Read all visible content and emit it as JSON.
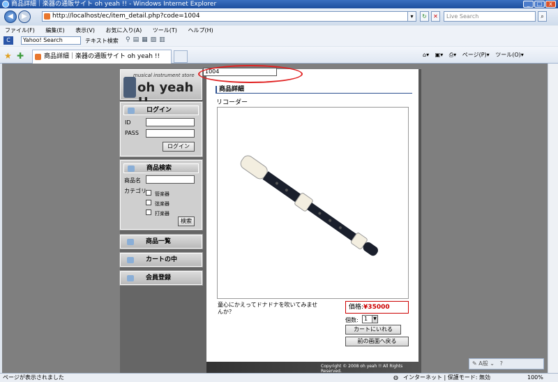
{
  "window": {
    "title": "商品詳細｜楽器の通販サイト oh yeah !! - Windows Internet Explorer"
  },
  "browser": {
    "address": "http://localhost/ec/item_detail.php?code=1004",
    "search_placeholder": "Live Search",
    "menu": [
      "ファイル(F)",
      "編集(E)",
      "表示(V)",
      "お気に入り(A)",
      "ツール(T)",
      "ヘルプ(H)"
    ],
    "yahoo_search": "Yahoo! Search",
    "text_search": "テキスト検索",
    "tab_title": "商品詳細｜楽器の通販サイト oh yeah !!",
    "page_menu": "ページ(P)",
    "tools_menu": "ツール(O)",
    "status_text": "ページが表示されました",
    "zone": "インターネット | 保護モード: 無効",
    "zoom": "100%"
  },
  "site": {
    "logo_small": "musical instrument store",
    "logo_big": "oh yeah !!",
    "login": {
      "title": "ログイン",
      "id_label": "ID",
      "pass_label": "PASS",
      "button": "ログイン"
    },
    "search": {
      "title": "商品検索",
      "name_label": "商品名",
      "category_label": "カテゴリ",
      "categories": [
        "管楽器",
        "弦楽器",
        "打楽器"
      ],
      "button": "検索"
    },
    "nav": [
      "商品一覧",
      "カートの中",
      "会員登録"
    ],
    "code_value": "1004",
    "heading": "商品詳細",
    "product_name": "リコーダー",
    "description": "童心にかえってドナドナを吹いてみませんか？",
    "price_label": "価格:",
    "price_value": "¥35000",
    "qty_label": "個数:",
    "qty_value": "1",
    "cart_button": "カートにいれる",
    "back_button": "前の画面へ戻る",
    "copyright": "Copyright © 2008 oh yeah !! All Rights Reserved."
  }
}
